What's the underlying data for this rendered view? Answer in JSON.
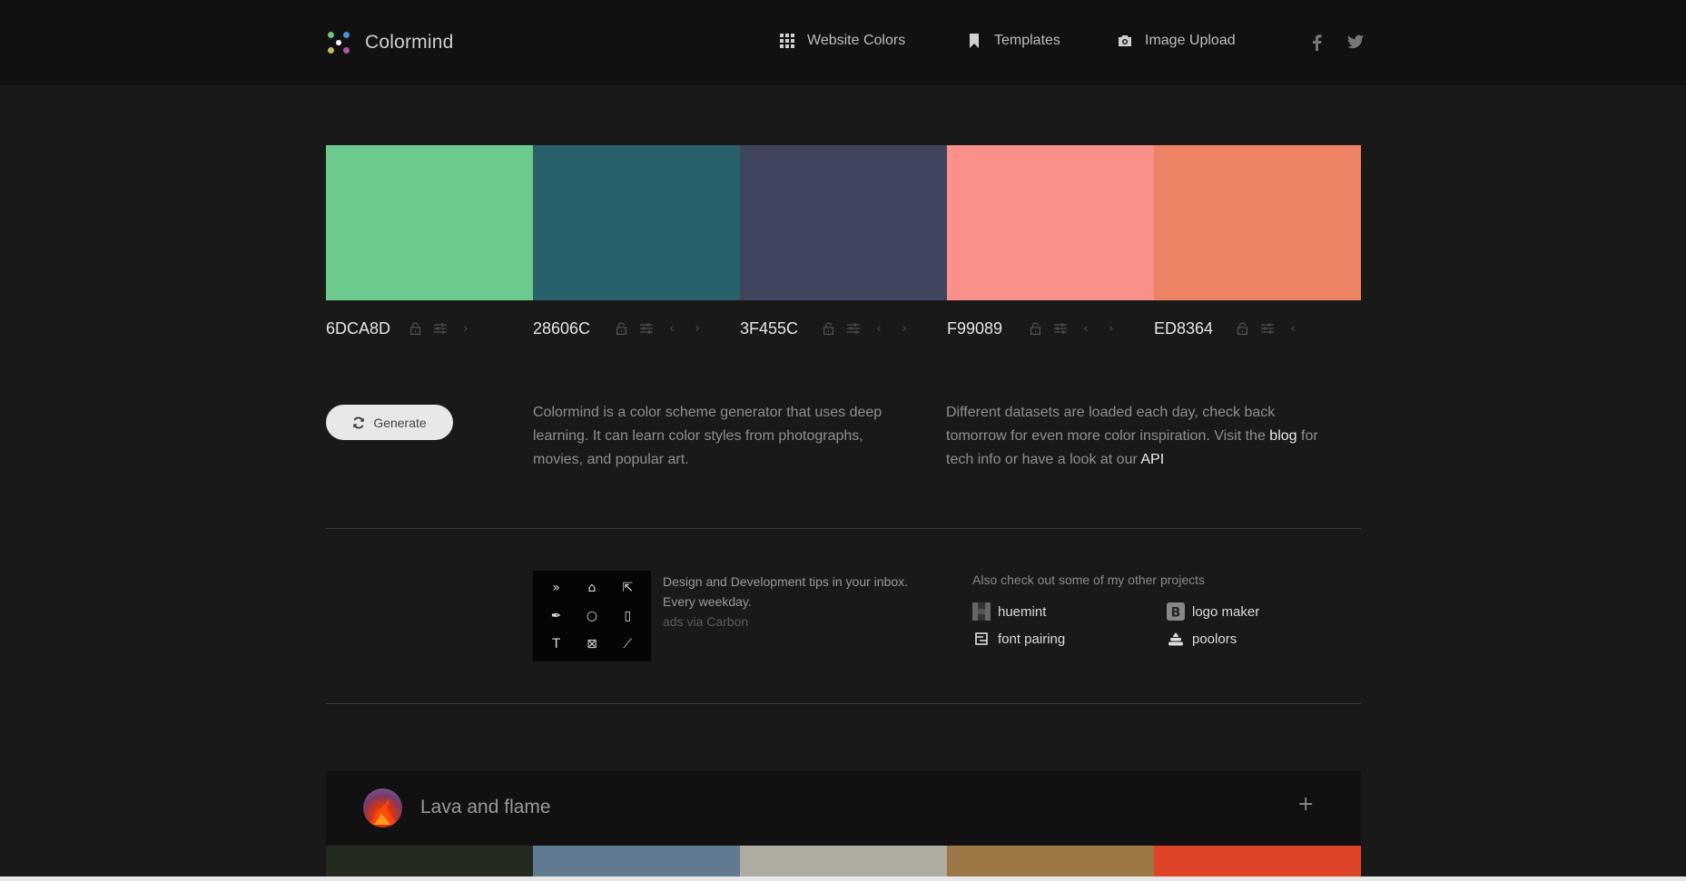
{
  "header": {
    "app_title": "Colormind",
    "nav": [
      {
        "label": "Website Colors",
        "icon": "grid-icon"
      },
      {
        "label": "Templates",
        "icon": "bookmark-icon"
      },
      {
        "label": "Image Upload",
        "icon": "camera-icon"
      }
    ],
    "social": [
      {
        "label": "f",
        "icon": "facebook-icon"
      },
      {
        "label": "twitter",
        "icon": "twitter-icon"
      }
    ]
  },
  "palette": {
    "colors": [
      {
        "hex": "6DCA8D",
        "color": "#6DCA8D",
        "controls": [
          "lock",
          "adjust",
          "right"
        ]
      },
      {
        "hex": "28606C",
        "color": "#28606C",
        "controls": [
          "lock",
          "adjust",
          "left",
          "right"
        ]
      },
      {
        "hex": "3F455C",
        "color": "#3F455C",
        "controls": [
          "lock",
          "adjust",
          "left",
          "right"
        ]
      },
      {
        "hex": "F99089",
        "color": "#F99089",
        "controls": [
          "lock",
          "adjust",
          "left",
          "right"
        ]
      },
      {
        "hex": "ED8364",
        "color": "#ED8364",
        "controls": [
          "lock",
          "adjust",
          "left"
        ]
      }
    ]
  },
  "actions": {
    "generate_label": "Generate"
  },
  "description": {
    "left": "Colormind is a color scheme generator that uses deep learning. It can learn color styles from photographs, movies, and popular art.",
    "right_part1": "Different datasets are loaded each day, check back tomorrow for even more color inspiration. Visit the ",
    "blog_link": "blog",
    "right_part2": " for tech info or have a look at our ",
    "api_link": "API"
  },
  "ad": {
    "text": "Design and Development tips in your inbox. Every weekday.",
    "via": "ads via Carbon"
  },
  "projects": {
    "title": "Also check out some of my other projects",
    "items": [
      {
        "label": "huemint",
        "icon": "huemint-icon"
      },
      {
        "label": "logo maker",
        "icon": "logo-maker-icon"
      },
      {
        "label": "font pairing",
        "icon": "font-pairing-icon"
      },
      {
        "label": "poolors",
        "icon": "poolors-icon"
      }
    ]
  },
  "featured": {
    "title": "Lava and flame",
    "expand_label": "+",
    "colors": [
      "#252A20",
      "#5F7A91",
      "#AEACA0",
      "#9C7645",
      "#DD4426"
    ]
  }
}
